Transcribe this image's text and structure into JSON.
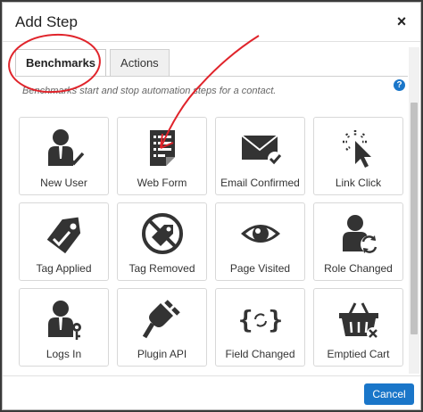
{
  "dialog": {
    "title": "Add Step",
    "close_symbol": "×"
  },
  "tabs": [
    {
      "label": "Benchmarks",
      "active": true
    },
    {
      "label": "Actions",
      "active": false
    }
  ],
  "description": "Benchmarks start and stop automation steps for a contact.",
  "help_symbol": "?",
  "cards": [
    {
      "label": "New User",
      "icon": "new-user-icon"
    },
    {
      "label": "Web Form",
      "icon": "web-form-icon"
    },
    {
      "label": "Email Confirmed",
      "icon": "email-confirmed-icon"
    },
    {
      "label": "Link Click",
      "icon": "link-click-icon"
    },
    {
      "label": "Tag Applied",
      "icon": "tag-applied-icon"
    },
    {
      "label": "Tag Removed",
      "icon": "tag-removed-icon"
    },
    {
      "label": "Page Visited",
      "icon": "page-visited-icon"
    },
    {
      "label": "Role Changed",
      "icon": "role-changed-icon"
    },
    {
      "label": "Logs In",
      "icon": "logs-in-icon"
    },
    {
      "label": "Plugin API",
      "icon": "plugin-api-icon"
    },
    {
      "label": "Field Changed",
      "icon": "field-changed-icon"
    },
    {
      "label": "Emptied Cart",
      "icon": "emptied-cart-icon"
    }
  ],
  "footer": {
    "cancel_label": "Cancel"
  },
  "colors": {
    "accent": "#1a76c9",
    "annotation": "#e0242b",
    "icon": "#333333"
  }
}
